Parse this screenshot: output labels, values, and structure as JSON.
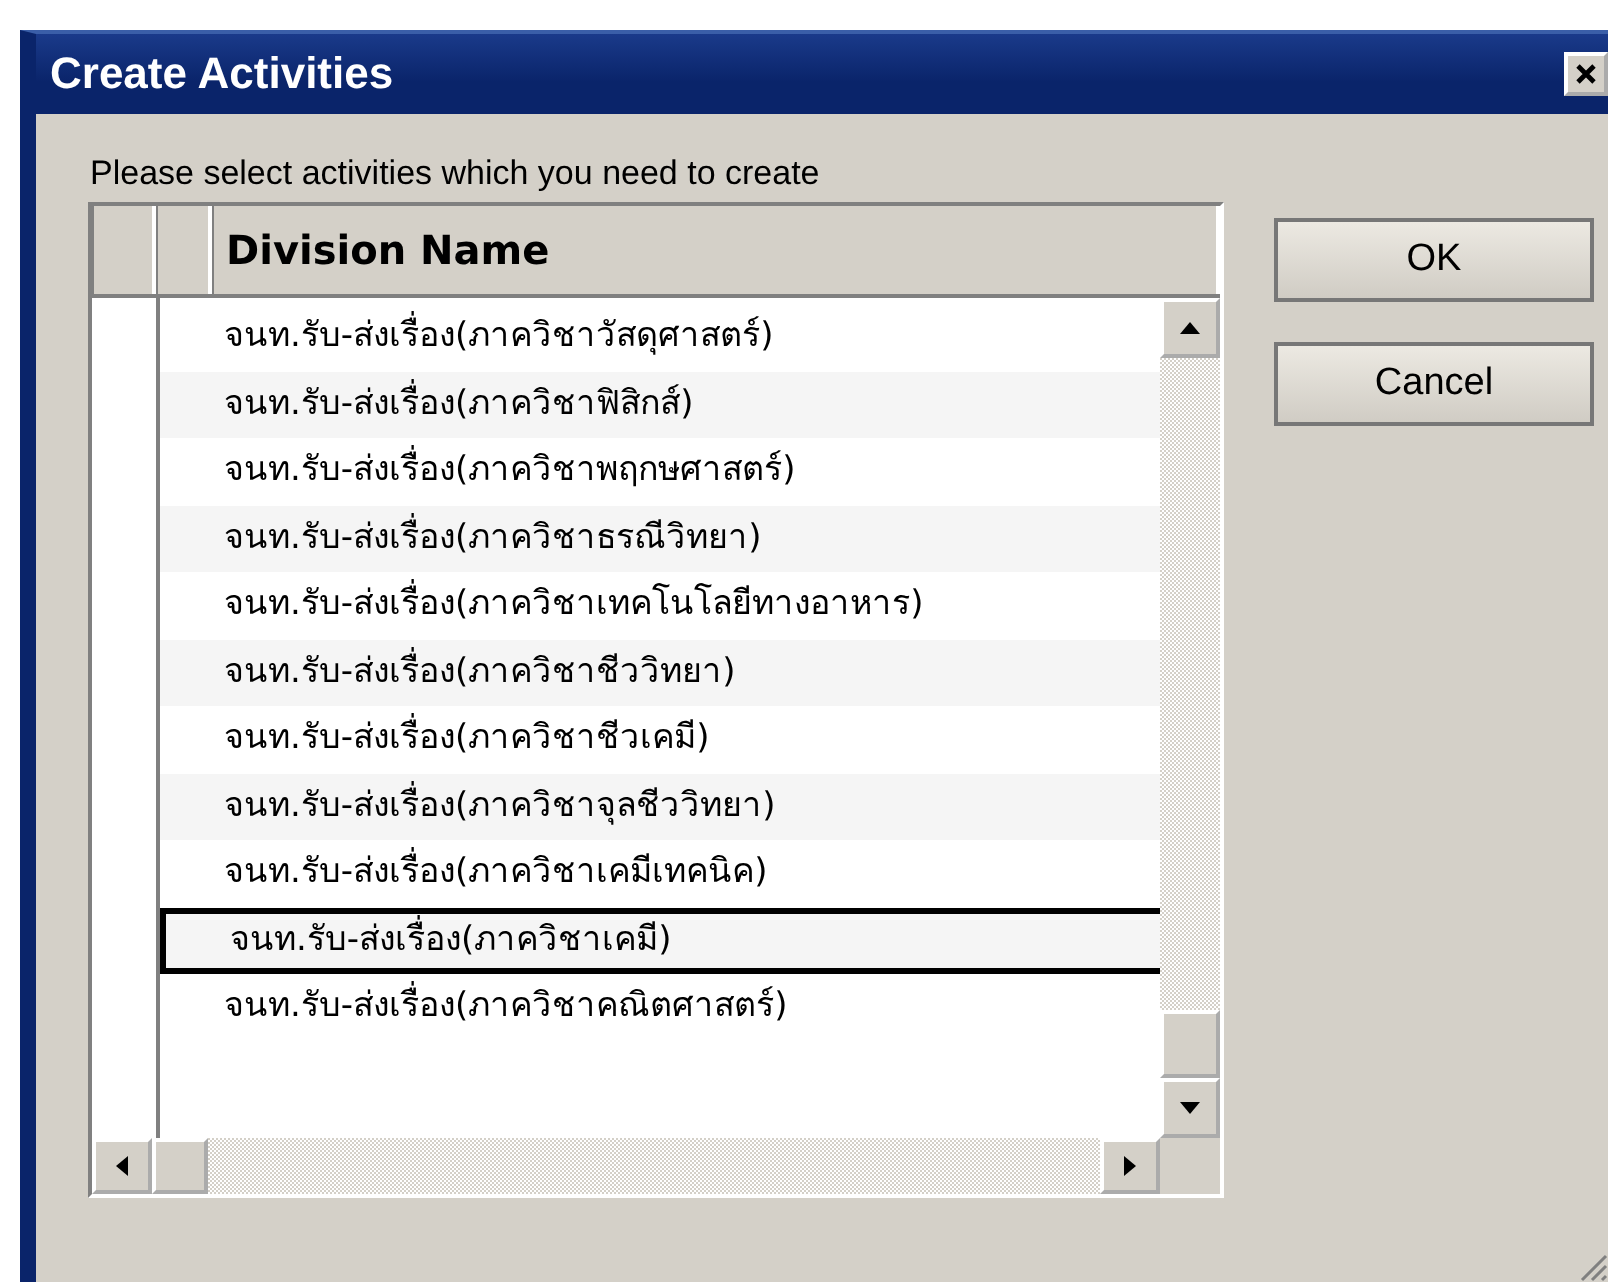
{
  "window": {
    "title": "Create Activities"
  },
  "instruction": "Please select activities which you need to create",
  "table": {
    "columns": [
      "Division Name"
    ],
    "rows": [
      {
        "name": "จนท.รับ-ส่งเรื่อง(ภาควิชาวัสดุศาสตร์)",
        "selected": false
      },
      {
        "name": "จนท.รับ-ส่งเรื่อง(ภาควิชาฟิสิกส์)",
        "selected": false
      },
      {
        "name": "จนท.รับ-ส่งเรื่อง(ภาควิชาพฤกษศาสตร์)",
        "selected": false
      },
      {
        "name": "จนท.รับ-ส่งเรื่อง(ภาควิชาธรณีวิทยา)",
        "selected": false
      },
      {
        "name": "จนท.รับ-ส่งเรื่อง(ภาควิชาเทคโนโลยีทางอาหาร)",
        "selected": false
      },
      {
        "name": "จนท.รับ-ส่งเรื่อง(ภาควิชาชีววิทยา)",
        "selected": false
      },
      {
        "name": "จนท.รับ-ส่งเรื่อง(ภาควิชาชีวเคมี)",
        "selected": false
      },
      {
        "name": "จนท.รับ-ส่งเรื่อง(ภาควิชาจุลชีววิทยา)",
        "selected": false
      },
      {
        "name": "จนท.รับ-ส่งเรื่อง(ภาควิชาเคมีเทคนิค)",
        "selected": false
      },
      {
        "name": "จนท.รับ-ส่งเรื่อง(ภาควิชาเคมี)",
        "selected": true
      },
      {
        "name": "จนท.รับ-ส่งเรื่อง(ภาควิชาคณิตศาสตร์)",
        "selected": false
      }
    ]
  },
  "buttons": [
    "OK",
    "Cancel"
  ]
}
